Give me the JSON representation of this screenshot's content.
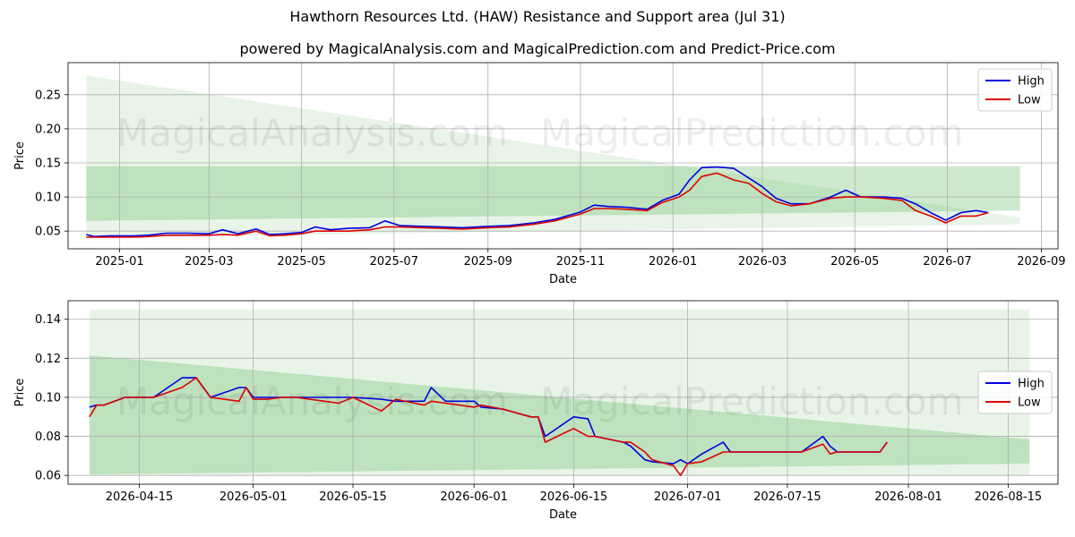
{
  "title": "Hawthorn Resources Ltd. (HAW) Resistance and Support area (Jul 31)",
  "subtitle": "powered by MagicalAnalysis.com and MagicalPrediction.com and Predict-Price.com",
  "watermark": [
    "MagicalAnalysis.com",
    "MagicalPrediction.com"
  ],
  "colors": {
    "high": "#0000dd",
    "low": "#dd0000",
    "band": "#5cb85c"
  },
  "chart_data": [
    {
      "type": "line",
      "title": "",
      "xlabel": "Date",
      "ylabel": "Price",
      "x_range": [
        "2024-11-28",
        "2026-09-12"
      ],
      "ylim": [
        0.024,
        0.297
      ],
      "grid": true,
      "legend": "top-right",
      "x_ticks": [
        "2025-01",
        "2025-03",
        "2025-05",
        "2025-07",
        "2025-09",
        "2025-11",
        "2026-01",
        "2026-03",
        "2026-05",
        "2026-07",
        "2026-09"
      ],
      "y_ticks": [
        "0.05",
        "0.10",
        "0.15",
        "0.20",
        "0.25"
      ],
      "bands": [
        {
          "name": "resistance-support-wide",
          "x": [
            "2024-12-10",
            "2026-08-18"
          ],
          "upper": [
            0.278,
            0.07
          ],
          "lower": [
            0.04,
            0.06
          ],
          "opacity": 0.15
        },
        {
          "name": "resistance-support-core",
          "x": [
            "2024-12-10",
            "2026-08-18"
          ],
          "upper": [
            0.145,
            0.145
          ],
          "lower": [
            0.065,
            0.08
          ],
          "opacity": 0.3
        }
      ],
      "series": [
        {
          "name": "High",
          "x": [
            "2024-12-10",
            "2024-12-15",
            "2024-12-25",
            "2025-01-10",
            "2025-01-20",
            "2025-02-01",
            "2025-02-15",
            "2025-03-01",
            "2025-03-10",
            "2025-03-20",
            "2025-04-01",
            "2025-04-10",
            "2025-04-20",
            "2025-05-01",
            "2025-05-10",
            "2025-05-20",
            "2025-06-01",
            "2025-06-15",
            "2025-06-25",
            "2025-07-05",
            "2025-07-20",
            "2025-08-01",
            "2025-08-15",
            "2025-09-01",
            "2025-09-15",
            "2025-10-01",
            "2025-10-15",
            "2025-11-01",
            "2025-11-10",
            "2025-11-20",
            "2025-12-01",
            "2025-12-15",
            "2025-12-25",
            "2026-01-05",
            "2026-01-12",
            "2026-01-20",
            "2026-01-30",
            "2026-02-10",
            "2026-02-20",
            "2026-03-01",
            "2026-03-10",
            "2026-03-20",
            "2026-04-01",
            "2026-04-15",
            "2026-04-25",
            "2026-05-05",
            "2026-05-20",
            "2026-06-01",
            "2026-06-10",
            "2026-06-20",
            "2026-06-30",
            "2026-07-10",
            "2026-07-20",
            "2026-07-28"
          ],
          "values": [
            0.045,
            0.042,
            0.043,
            0.043,
            0.044,
            0.047,
            0.047,
            0.046,
            0.052,
            0.046,
            0.053,
            0.045,
            0.046,
            0.048,
            0.056,
            0.052,
            0.054,
            0.055,
            0.065,
            0.058,
            0.057,
            0.056,
            0.055,
            0.057,
            0.058,
            0.062,
            0.067,
            0.078,
            0.088,
            0.086,
            0.085,
            0.082,
            0.095,
            0.104,
            0.125,
            0.143,
            0.144,
            0.142,
            0.128,
            0.115,
            0.098,
            0.09,
            0.09,
            0.1,
            0.11,
            0.1,
            0.1,
            0.098,
            0.09,
            0.077,
            0.066,
            0.077,
            0.08,
            0.077
          ]
        },
        {
          "name": "Low",
          "x": [
            "2024-12-10",
            "2024-12-15",
            "2024-12-25",
            "2025-01-10",
            "2025-01-20",
            "2025-02-01",
            "2025-02-15",
            "2025-03-01",
            "2025-03-10",
            "2025-03-20",
            "2025-04-01",
            "2025-04-10",
            "2025-04-20",
            "2025-05-01",
            "2025-05-10",
            "2025-05-20",
            "2025-06-01",
            "2025-06-15",
            "2025-06-25",
            "2025-07-05",
            "2025-07-20",
            "2025-08-01",
            "2025-08-15",
            "2025-09-01",
            "2025-09-15",
            "2025-10-01",
            "2025-10-15",
            "2025-11-01",
            "2025-11-10",
            "2025-11-20",
            "2025-12-01",
            "2025-12-15",
            "2025-12-25",
            "2026-01-05",
            "2026-01-12",
            "2026-01-20",
            "2026-01-30",
            "2026-02-10",
            "2026-02-20",
            "2026-03-01",
            "2026-03-10",
            "2026-03-20",
            "2026-04-01",
            "2026-04-15",
            "2026-04-25",
            "2026-05-05",
            "2026-05-20",
            "2026-06-01",
            "2026-06-10",
            "2026-06-20",
            "2026-06-30",
            "2026-07-10",
            "2026-07-20",
            "2026-07-28"
          ],
          "values": [
            0.041,
            0.041,
            0.041,
            0.041,
            0.042,
            0.044,
            0.044,
            0.044,
            0.045,
            0.044,
            0.05,
            0.043,
            0.044,
            0.046,
            0.05,
            0.05,
            0.05,
            0.052,
            0.056,
            0.056,
            0.055,
            0.054,
            0.053,
            0.055,
            0.056,
            0.06,
            0.065,
            0.075,
            0.083,
            0.083,
            0.082,
            0.08,
            0.092,
            0.1,
            0.11,
            0.13,
            0.135,
            0.125,
            0.12,
            0.105,
            0.093,
            0.087,
            0.09,
            0.098,
            0.1,
            0.1,
            0.098,
            0.095,
            0.08,
            0.072,
            0.062,
            0.072,
            0.072,
            0.077
          ]
        }
      ]
    },
    {
      "type": "line",
      "title": "",
      "xlabel": "Date",
      "ylabel": "Price",
      "x_range": [
        "2026-04-05",
        "2026-08-22"
      ],
      "ylim": [
        0.0555,
        0.1495
      ],
      "grid": true,
      "legend": "center-right",
      "x_ticks": [
        "2026-04-15",
        "2026-05-01",
        "2026-05-15",
        "2026-06-01",
        "2026-06-15",
        "2026-07-01",
        "2026-07-15",
        "2026-08-01",
        "2026-08-15"
      ],
      "y_ticks": [
        "0.06",
        "0.08",
        "0.10",
        "0.12",
        "0.14"
      ],
      "bands": [
        {
          "name": "resistance-support-wide",
          "x": [
            "2026-04-08",
            "2026-08-18"
          ],
          "upper": [
            0.145,
            0.145
          ],
          "lower": [
            0.06,
            0.06
          ],
          "opacity": 0.15
        },
        {
          "name": "resistance-support-core",
          "x": [
            "2026-04-08",
            "2026-08-18"
          ],
          "upper": [
            0.1215,
            0.0785
          ],
          "lower": [
            0.0605,
            0.066
          ],
          "opacity": 0.3
        }
      ],
      "series": [
        {
          "name": "High",
          "x": [
            "2026-04-08",
            "2026-04-09",
            "2026-04-10",
            "2026-04-13",
            "2026-04-17",
            "2026-04-21",
            "2026-04-23",
            "2026-04-25",
            "2026-04-29",
            "2026-04-30",
            "2026-05-01",
            "2026-05-03",
            "2026-05-05",
            "2026-05-07",
            "2026-05-11",
            "2026-05-13",
            "2026-05-15",
            "2026-05-19",
            "2026-05-21",
            "2026-05-25",
            "2026-05-26",
            "2026-05-28",
            "2026-06-01",
            "2026-06-02",
            "2026-06-05",
            "2026-06-09",
            "2026-06-10",
            "2026-06-11",
            "2026-06-15",
            "2026-06-17",
            "2026-06-18",
            "2026-06-22",
            "2026-06-23",
            "2026-06-25",
            "2026-06-26",
            "2026-06-29",
            "2026-06-30",
            "2026-07-01",
            "2026-07-03",
            "2026-07-06",
            "2026-07-07",
            "2026-07-17",
            "2026-07-20",
            "2026-07-21",
            "2026-07-22",
            "2026-07-28",
            "2026-07-29"
          ],
          "values": [
            0.095,
            0.096,
            0.096,
            0.1,
            0.1,
            0.11,
            0.11,
            0.1,
            0.105,
            0.105,
            0.1,
            0.1,
            0.1,
            0.1,
            0.1,
            0.1,
            0.1,
            0.099,
            0.098,
            0.098,
            0.105,
            0.098,
            0.098,
            0.095,
            0.094,
            0.09,
            0.09,
            0.08,
            0.09,
            0.089,
            0.08,
            0.077,
            0.075,
            0.068,
            0.067,
            0.066,
            0.068,
            0.066,
            0.071,
            0.077,
            0.072,
            0.072,
            0.08,
            0.075,
            0.072,
            0.072,
            0.077
          ]
        },
        {
          "name": "Low",
          "x": [
            "2026-04-08",
            "2026-04-09",
            "2026-04-10",
            "2026-04-13",
            "2026-04-17",
            "2026-04-21",
            "2026-04-23",
            "2026-04-25",
            "2026-04-29",
            "2026-04-30",
            "2026-05-01",
            "2026-05-03",
            "2026-05-05",
            "2026-05-07",
            "2026-05-11",
            "2026-05-13",
            "2026-05-15",
            "2026-05-19",
            "2026-05-21",
            "2026-05-25",
            "2026-05-26",
            "2026-05-28",
            "2026-06-01",
            "2026-06-02",
            "2026-06-05",
            "2026-06-09",
            "2026-06-10",
            "2026-06-11",
            "2026-06-15",
            "2026-06-17",
            "2026-06-18",
            "2026-06-22",
            "2026-06-23",
            "2026-06-25",
            "2026-06-26",
            "2026-06-29",
            "2026-06-30",
            "2026-07-01",
            "2026-07-03",
            "2026-07-06",
            "2026-07-07",
            "2026-07-17",
            "2026-07-20",
            "2026-07-21",
            "2026-07-22",
            "2026-07-28",
            "2026-07-29"
          ],
          "values": [
            0.09,
            0.096,
            0.096,
            0.1,
            0.1,
            0.105,
            0.11,
            0.1,
            0.098,
            0.105,
            0.099,
            0.099,
            0.1,
            0.1,
            0.098,
            0.097,
            0.1,
            0.093,
            0.099,
            0.096,
            0.098,
            0.097,
            0.095,
            0.096,
            0.094,
            0.09,
            0.09,
            0.077,
            0.084,
            0.08,
            0.08,
            0.077,
            0.077,
            0.072,
            0.068,
            0.065,
            0.06,
            0.066,
            0.067,
            0.072,
            0.072,
            0.072,
            0.076,
            0.071,
            0.072,
            0.072,
            0.077
          ]
        }
      ]
    }
  ]
}
